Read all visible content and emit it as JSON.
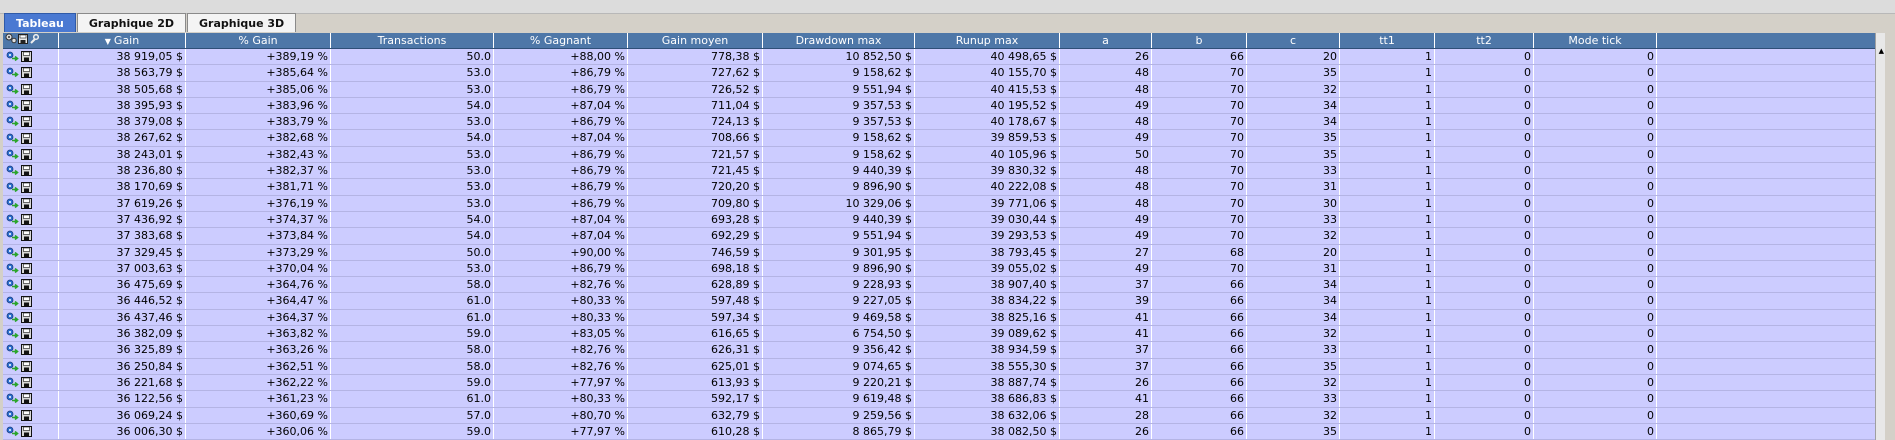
{
  "tabs": [
    {
      "label": "Tableau",
      "active": true
    },
    {
      "label": "Graphique 2D",
      "active": false
    },
    {
      "label": "Graphique 3D",
      "active": false
    }
  ],
  "columns": [
    "Gain",
    "% Gain",
    "Transactions",
    "% Gagnant",
    "Gain moyen",
    "Drawdown max",
    "Runup max",
    "a",
    "b",
    "c",
    "tt1",
    "tt2",
    "Mode tick"
  ],
  "header_icons": [
    "gear-icon",
    "save-icon",
    "wrench-icon"
  ],
  "sort_arrow": "▼",
  "scroll_arrow": "▲",
  "colors": {
    "header_bg": "#4e77a8",
    "grid_bg": "#ccccff",
    "tab_active": "#4a79d2"
  },
  "rows": [
    [
      "38 919,05 $",
      "+389,19 %",
      "50.0",
      "+88,00 %",
      "778,38 $",
      "10 852,50 $",
      "40 498,65 $",
      "26",
      "66",
      "20",
      "1",
      "0",
      "0"
    ],
    [
      "38 563,79 $",
      "+385,64 %",
      "53.0",
      "+86,79 %",
      "727,62 $",
      "9 158,62 $",
      "40 155,70 $",
      "48",
      "70",
      "35",
      "1",
      "0",
      "0"
    ],
    [
      "38 505,68 $",
      "+385,06 %",
      "53.0",
      "+86,79 %",
      "726,52 $",
      "9 551,94 $",
      "40 415,53 $",
      "48",
      "70",
      "32",
      "1",
      "0",
      "0"
    ],
    [
      "38 395,93 $",
      "+383,96 %",
      "54.0",
      "+87,04 %",
      "711,04 $",
      "9 357,53 $",
      "40 195,52 $",
      "49",
      "70",
      "34",
      "1",
      "0",
      "0"
    ],
    [
      "38 379,08 $",
      "+383,79 %",
      "53.0",
      "+86,79 %",
      "724,13 $",
      "9 357,53 $",
      "40 178,67 $",
      "48",
      "70",
      "34",
      "1",
      "0",
      "0"
    ],
    [
      "38 267,62 $",
      "+382,68 %",
      "54.0",
      "+87,04 %",
      "708,66 $",
      "9 158,62 $",
      "39 859,53 $",
      "49",
      "70",
      "35",
      "1",
      "0",
      "0"
    ],
    [
      "38 243,01 $",
      "+382,43 %",
      "53.0",
      "+86,79 %",
      "721,57 $",
      "9 158,62 $",
      "40 105,96 $",
      "50",
      "70",
      "35",
      "1",
      "0",
      "0"
    ],
    [
      "38 236,80 $",
      "+382,37 %",
      "53.0",
      "+86,79 %",
      "721,45 $",
      "9 440,39 $",
      "39 830,32 $",
      "48",
      "70",
      "33",
      "1",
      "0",
      "0"
    ],
    [
      "38 170,69 $",
      "+381,71 %",
      "53.0",
      "+86,79 %",
      "720,20 $",
      "9 896,90 $",
      "40 222,08 $",
      "48",
      "70",
      "31",
      "1",
      "0",
      "0"
    ],
    [
      "37 619,26 $",
      "+376,19 %",
      "53.0",
      "+86,79 %",
      "709,80 $",
      "10 329,06 $",
      "39 771,06 $",
      "48",
      "70",
      "30",
      "1",
      "0",
      "0"
    ],
    [
      "37 436,92 $",
      "+374,37 %",
      "54.0",
      "+87,04 %",
      "693,28 $",
      "9 440,39 $",
      "39 030,44 $",
      "49",
      "70",
      "33",
      "1",
      "0",
      "0"
    ],
    [
      "37 383,68 $",
      "+373,84 %",
      "54.0",
      "+87,04 %",
      "692,29 $",
      "9 551,94 $",
      "39 293,53 $",
      "49",
      "70",
      "32",
      "1",
      "0",
      "0"
    ],
    [
      "37 329,45 $",
      "+373,29 %",
      "50.0",
      "+90,00 %",
      "746,59 $",
      "9 301,95 $",
      "38 793,45 $",
      "27",
      "68",
      "20",
      "1",
      "0",
      "0"
    ],
    [
      "37 003,63 $",
      "+370,04 %",
      "53.0",
      "+86,79 %",
      "698,18 $",
      "9 896,90 $",
      "39 055,02 $",
      "49",
      "70",
      "31",
      "1",
      "0",
      "0"
    ],
    [
      "36 475,69 $",
      "+364,76 %",
      "58.0",
      "+82,76 %",
      "628,89 $",
      "9 228,93 $",
      "38 907,40 $",
      "37",
      "66",
      "34",
      "1",
      "0",
      "0"
    ],
    [
      "36 446,52 $",
      "+364,47 %",
      "61.0",
      "+80,33 %",
      "597,48 $",
      "9 227,05 $",
      "38 834,22 $",
      "39",
      "66",
      "34",
      "1",
      "0",
      "0"
    ],
    [
      "36 437,46 $",
      "+364,37 %",
      "61.0",
      "+80,33 %",
      "597,34 $",
      "9 469,58 $",
      "38 825,16 $",
      "41",
      "66",
      "34",
      "1",
      "0",
      "0"
    ],
    [
      "36 382,09 $",
      "+363,82 %",
      "59.0",
      "+83,05 %",
      "616,65 $",
      "6 754,50 $",
      "39 089,62 $",
      "41",
      "66",
      "32",
      "1",
      "0",
      "0"
    ],
    [
      "36 325,89 $",
      "+363,26 %",
      "58.0",
      "+82,76 %",
      "626,31 $",
      "9 356,42 $",
      "38 934,59 $",
      "37",
      "66",
      "33",
      "1",
      "0",
      "0"
    ],
    [
      "36 250,84 $",
      "+362,51 %",
      "58.0",
      "+82,76 %",
      "625,01 $",
      "9 074,65 $",
      "38 555,30 $",
      "37",
      "66",
      "35",
      "1",
      "0",
      "0"
    ],
    [
      "36 221,68 $",
      "+362,22 %",
      "59.0",
      "+77,97 %",
      "613,93 $",
      "9 220,21 $",
      "38 887,74 $",
      "26",
      "66",
      "32",
      "1",
      "0",
      "0"
    ],
    [
      "36 122,56 $",
      "+361,23 %",
      "61.0",
      "+80,33 %",
      "592,17 $",
      "9 619,48 $",
      "38 686,83 $",
      "41",
      "66",
      "33",
      "1",
      "0",
      "0"
    ],
    [
      "36 069,24 $",
      "+360,69 %",
      "57.0",
      "+80,70 %",
      "632,79 $",
      "9 259,56 $",
      "38 632,06 $",
      "28",
      "66",
      "32",
      "1",
      "0",
      "0"
    ],
    [
      "36 006,30 $",
      "+360,06 %",
      "59.0",
      "+77,97 %",
      "610,28 $",
      "8 865,79 $",
      "38 082,50 $",
      "26",
      "66",
      "35",
      "1",
      "0",
      "0"
    ]
  ]
}
